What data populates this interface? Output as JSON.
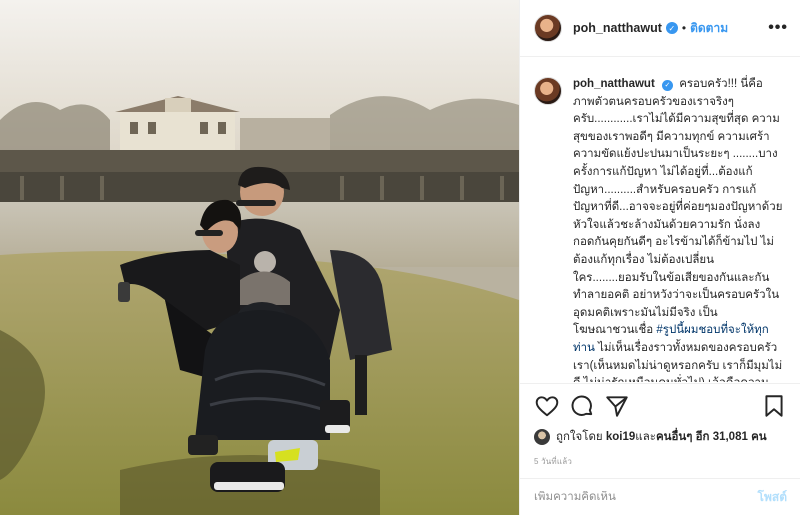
{
  "header": {
    "username": "poh_natthawut",
    "separator": "•",
    "follow_label": "ติดตาม",
    "more_label": "•••",
    "verified_mark": "✓"
  },
  "caption": {
    "username": "poh_natthawut",
    "text_parts": [
      "ครอบครัว!!! นี่คือภาพตัวตนครอบครัวของเราจริงๆครับ............เราไม่ได้มีความสุขที่สุด ความสุขของเราพอดีๆ มีความทุกข์ ความเศร้า ความขัดแย้งปะปนมาเป็นระยะๆ ........บางครั้งการแก้ปัญหา ไม่ได้อยู่ที่...ต้องแก้ปัญหา..........สำหรับครอบครัว การแก้ปัญหาที่ดี...อาจจะอยู่ที่ค่อยๆมองปัญหาด้วยหัวใจแล้วชะล้างมันด้วยความรัก นั่งลง กอดกันคุยกันดีๆ อะไรข้ามได้ก็ข้ามไป ไม่ต้องแก้ทุกเรื่อง ไม่ต้องเปลี่ยนใคร........ยอมรับในข้อเสียของกันและกัน ทำลายอคติ อย่าหวังว่าจะเป็นครอบครัวในอุดมคติเพราะมันไม่มีจริง เป็นโฆษณาชวนเชื่อ ",
      "#รูปนี้ผมชอบที่จะให้ทุกท่าน",
      " ไม่เห็นเรื่องราวทั้งหมดของครอบครัวเรา(เห็นหมดไม่น่าดูหรอกครับ เราก็มีมุมไม่ดี ไม่น่ารักเหมือนคนทั่วไป) เอ้อคือความงดงามของบ้านของเรา พี่ภูติศคือปึ่งจิ๋ว ผู้เคร่งขรึมแต่รักสนุกในเวลาเดียวกัน พี่เภาคือรอยยิ้มและความสดใส(ที่ผมต้อง"
    ]
  },
  "actions": {
    "like_icon": "heart-icon",
    "comment_icon": "comment-icon",
    "share_icon": "share-icon",
    "save_icon": "bookmark-icon"
  },
  "likes": {
    "prefix": "ถูกใจโดย ",
    "first_user": "koi19",
    "middle": " และ ",
    "others": "คนอื่นๆ อีก 31,081 คน"
  },
  "timestamp": "5 วันที่แล้ว",
  "comment_box": {
    "placeholder": "เพิ่มความคิดเห็น",
    "post_label": "โพสต์"
  },
  "colors": {
    "link_blue": "#3897f0",
    "post_disabled": "#b2dffc",
    "hashtag": "#003569"
  }
}
